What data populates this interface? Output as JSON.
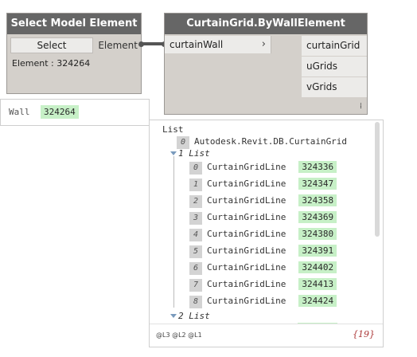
{
  "select_node": {
    "title": "Select Model Element",
    "select_label": "Select",
    "output_label": "Element",
    "readout": "Element : 324264",
    "preview_label": "Wall",
    "preview_value": "324264"
  },
  "curtain_node": {
    "title": "CurtainGrid.ByWallElement",
    "input_label": "curtainWall",
    "input_chevron": "›",
    "outputs": [
      "curtainGrid",
      "uGrids",
      "vGrids"
    ],
    "lacing_mark": "⁞"
  },
  "preview": {
    "root_label": "List",
    "item0_index": "0",
    "item0_value": "Autodesk.Revit.DB.CurtainGrid",
    "sublist1_label": "1 List",
    "lines": [
      {
        "index": "0",
        "type": "CurtainGridLine",
        "id": "324336"
      },
      {
        "index": "1",
        "type": "CurtainGridLine",
        "id": "324347"
      },
      {
        "index": "2",
        "type": "CurtainGridLine",
        "id": "324358"
      },
      {
        "index": "3",
        "type": "CurtainGridLine",
        "id": "324369"
      },
      {
        "index": "4",
        "type": "CurtainGridLine",
        "id": "324380"
      },
      {
        "index": "5",
        "type": "CurtainGridLine",
        "id": "324391"
      },
      {
        "index": "6",
        "type": "CurtainGridLine",
        "id": "324402"
      },
      {
        "index": "7",
        "type": "CurtainGridLine",
        "id": "324413"
      },
      {
        "index": "8",
        "type": "CurtainGridLine",
        "id": "324424"
      }
    ],
    "sublist2_label": "2 List",
    "levels": "@L3 @L2 @L1",
    "count_open": "{",
    "count": "19",
    "count_close": "}"
  },
  "colors": {
    "node_header": "#666666",
    "node_body": "#d4d0cb",
    "port_bg": "#ecebe9",
    "value_highlight": "#c7f0c7",
    "wire": "#555555",
    "count": "#aa3333"
  }
}
